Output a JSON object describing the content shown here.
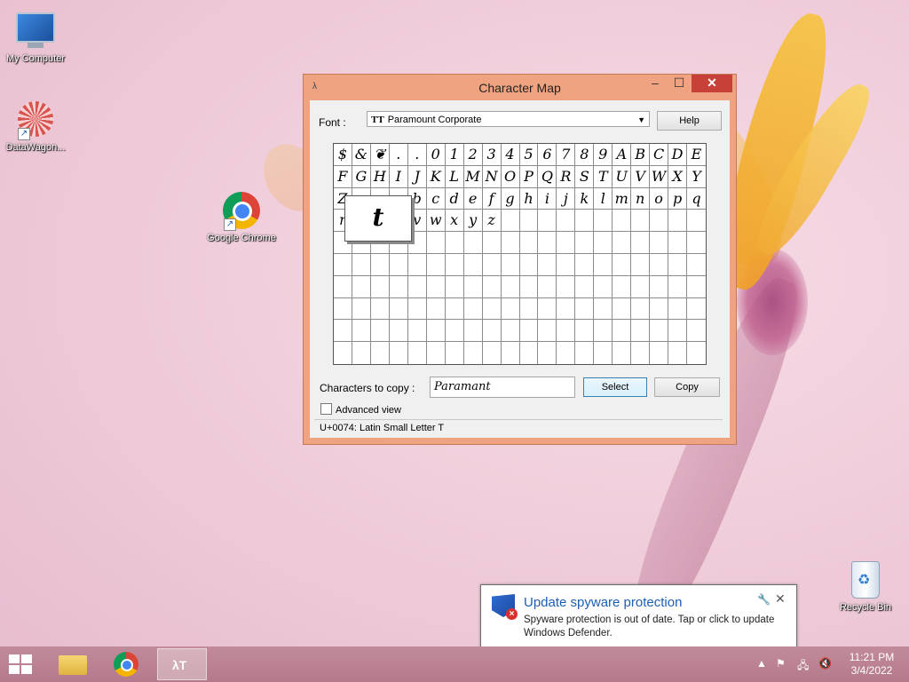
{
  "desktop": {
    "icons": [
      {
        "label": "My Computer"
      },
      {
        "label": "DataWagon..."
      },
      {
        "label": "Google Chrome"
      },
      {
        "label": "Recycle Bin"
      }
    ]
  },
  "charmap": {
    "title": "Character Map",
    "font_label": "Font :",
    "font_value": "Paramount Corporate",
    "help_label": "Help",
    "grid": [
      [
        "$",
        "&",
        "❦",
        ".",
        ".",
        "0",
        "1",
        "2",
        "3",
        "4",
        "5",
        "6",
        "7",
        "8",
        "9",
        "A",
        "B",
        "C",
        "D",
        "E"
      ],
      [
        "F",
        "G",
        "H",
        "I",
        "J",
        "K",
        "L",
        "M",
        "N",
        "O",
        "P",
        "Q",
        "R",
        "S",
        "T",
        "U",
        "V",
        "W",
        "X",
        "Y"
      ],
      [
        "Z",
        "",
        "",
        "",
        "b",
        "c",
        "d",
        "e",
        "f",
        "g",
        "h",
        "i",
        "j",
        "k",
        "l",
        "m",
        "n",
        "o",
        "p",
        "q"
      ],
      [
        "r",
        "",
        "",
        "",
        "v",
        "w",
        "x",
        "y",
        "z",
        "",
        "",
        "",
        "",
        "",
        "",
        "",
        "",
        "",
        "",
        ""
      ],
      [
        "",
        "",
        "",
        "",
        "",
        "",
        "",
        "",
        "",
        "",
        "",
        "",
        "",
        "",
        "",
        "",
        "",
        "",
        "",
        ""
      ],
      [
        "",
        "",
        "",
        "",
        "",
        "",
        "",
        "",
        "",
        "",
        "",
        "",
        "",
        "",
        "",
        "",
        "",
        "",
        "",
        ""
      ],
      [
        "",
        "",
        "",
        "",
        "",
        "",
        "",
        "",
        "",
        "",
        "",
        "",
        "",
        "",
        "",
        "",
        "",
        "",
        "",
        ""
      ],
      [
        "",
        "",
        "",
        "",
        "",
        "",
        "",
        "",
        "",
        "",
        "",
        "",
        "",
        "",
        "",
        "",
        "",
        "",
        "",
        ""
      ],
      [
        "",
        "",
        "",
        "",
        "",
        "",
        "",
        "",
        "",
        "",
        "",
        "",
        "",
        "",
        "",
        "",
        "",
        "",
        "",
        ""
      ],
      [
        "",
        "",
        "",
        "",
        "",
        "",
        "",
        "",
        "",
        "",
        "",
        "",
        "",
        "",
        "",
        "",
        "",
        "",
        "",
        ""
      ]
    ],
    "zoom_char": "t",
    "copy_label": "Characters to copy :",
    "copy_value": "Paramant",
    "select_label": "Select",
    "copy_button_label": "Copy",
    "advanced_label": "Advanced view",
    "status": "U+0074: Latin Small Letter T"
  },
  "notification": {
    "title": "Update spyware protection",
    "body": "Spyware protection is out of date. Tap or click to update Windows Defender."
  },
  "taskbar": {
    "time": "11:21 PM",
    "date": "3/4/2022"
  },
  "colors": {
    "window_frame": "#f0a381",
    "close_button": "#c74138",
    "accent_blue": "#1d5fb4"
  }
}
